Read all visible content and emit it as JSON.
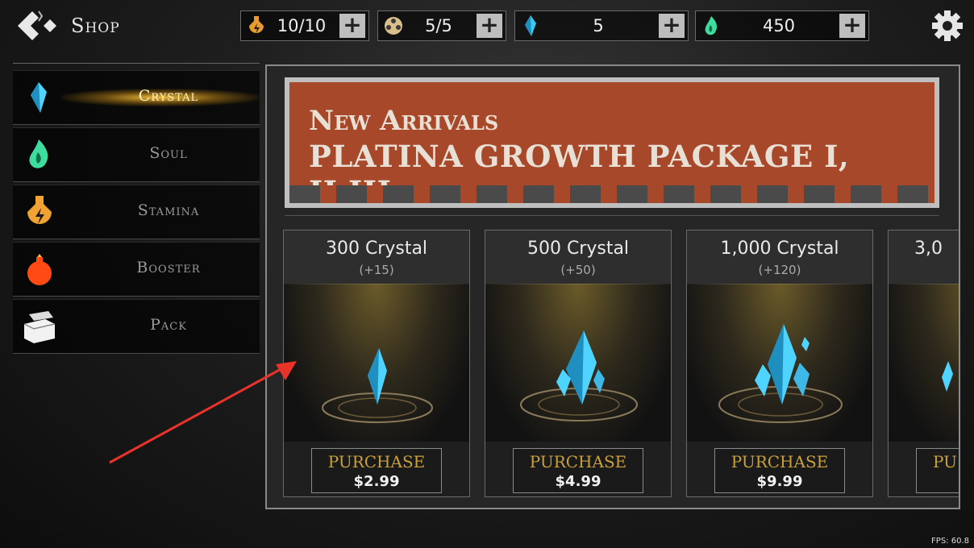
{
  "header": {
    "title": "Shop"
  },
  "resources": [
    {
      "name": "stamina",
      "icon": "stamina-potion-icon",
      "value": "10/10",
      "plus": "+"
    },
    {
      "name": "tickets",
      "icon": "film-reel-icon",
      "value": "5/5",
      "plus": "+"
    },
    {
      "name": "crystal",
      "icon": "crystal-icon",
      "value": "5",
      "plus": "+"
    },
    {
      "name": "soul",
      "icon": "soul-flame-icon",
      "value": "450",
      "plus": "+"
    }
  ],
  "sidebar": {
    "items": [
      {
        "label": "Crystal",
        "icon": "crystal-icon",
        "active": true
      },
      {
        "label": "Soul",
        "icon": "soul-flame-icon"
      },
      {
        "label": "Stamina",
        "icon": "stamina-potion-icon"
      },
      {
        "label": "Booster",
        "icon": "booster-bomb-icon"
      },
      {
        "label": "Pack",
        "icon": "pack-box-icon"
      }
    ]
  },
  "banner": {
    "subtitle": "New Arrivals",
    "title": "PLATINA GROWTH PACKAGE I, II,III"
  },
  "products": [
    {
      "amount": "300 Crystal",
      "bonus": "(+15)",
      "button": "PURCHASE",
      "price": "$2.99"
    },
    {
      "amount": "500 Crystal",
      "bonus": "(+50)",
      "button": "PURCHASE",
      "price": "$4.99"
    },
    {
      "amount": "1,000 Crystal",
      "bonus": "(+120)",
      "button": "PURCHASE",
      "price": "$9.99"
    },
    {
      "amount": "3,0",
      "bonus": "",
      "button": "PU",
      "price": ""
    }
  ],
  "fps": "FPS: 60.8",
  "colors": {
    "accent_gold": "#c9a03a",
    "banner_orange": "#a8482a",
    "crystal_blue": "#3fc8f2",
    "soul_green": "#3fdca0",
    "arrow_red": "#e8332a"
  }
}
